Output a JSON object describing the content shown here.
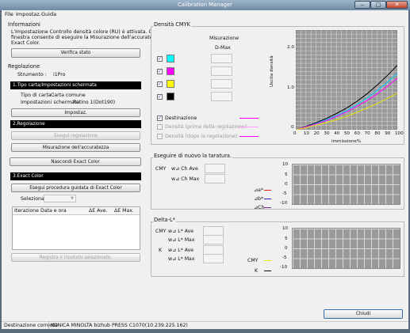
{
  "window": {
    "title": "Calibration Manager",
    "min": "‒",
    "max": "□",
    "close": "✕"
  },
  "menu": [
    "File",
    "Impostaz.",
    "Guida"
  ],
  "left": {
    "info_heading": "Informazioni",
    "info_line1": "L'Impostazione Controllo densità colore (RU) è attivata. Questa",
    "info_line2": "finestra consente di eseguire la Misurazione dell'accuratezza e",
    "info_line3": "Exact Color.",
    "verify_button": "Verifica stato",
    "reg_heading": "Regolazione",
    "instrument_label": "Strumento :",
    "instrument_value": "i1Pro",
    "section1": "1.Tipo carta/Impostazioni schermata",
    "paper_label": "Tipo di carta :",
    "paper_value": "Carta comune",
    "screen_label": "Impostazioni schermata :",
    "screen_value": "Retino 1(Dot190)",
    "settings_button": "Impostaz.",
    "section2": "2.Regolazione",
    "run_adjust_button": "Esegui regolazione",
    "accuracy_button": "Misurazione dell'accuratezza",
    "hide_exact_button": "Nascondi Exact Color",
    "section3": "3.Exact Color",
    "exact_guided_button": "Esegui procedura guidata di Exact Color",
    "select_label": "Seleziona",
    "select_value": "",
    "table_headers": [
      "Iterazione",
      "Data e ora",
      "ΔE Ave.",
      "ΔE Max."
    ],
    "register_button": "Registra il risultato selezionato."
  },
  "cmyk": {
    "heading": "Densità CMYK",
    "measure_label": "Misurazione",
    "dmax_label": "D-Max",
    "colors": [
      "#00ffff",
      "#ff00ff",
      "#ffff00",
      "#000000"
    ],
    "check_mark": "✓",
    "legend": [
      {
        "label": "Destinazione",
        "color": "#ff00ff",
        "checked": true,
        "enabled": true
      },
      {
        "label": "Densità (prima della regolazione)",
        "color": "#ff9fff",
        "checked": false,
        "enabled": false
      },
      {
        "label": "Densità (dopo la regolazione)",
        "color": "#ff00ff",
        "checked": false,
        "enabled": false
      }
    ],
    "ylabel": "Uscita densità",
    "xlabel": "immissione%",
    "y_ticks": [
      "2.0",
      "1.0",
      "0"
    ],
    "x_ticks": [
      "0",
      "10",
      "20",
      "30",
      "40",
      "50",
      "60",
      "70",
      "80",
      "90",
      "100"
    ]
  },
  "rerun": {
    "heading": "Eseguire di nuovo la taratura.",
    "cmy_label": "CMY",
    "ch_ave_label": "w⊿ Ch Ave",
    "ch_max_label": "w⊿ Ch Max",
    "legend": [
      {
        "label": "⊿a*",
        "color": "#e02020"
      },
      {
        "label": "⊿b*",
        "color": "#2020c0"
      },
      {
        "label": "⊿Ch",
        "color": "#7a20a0"
      }
    ],
    "y_ticks": [
      "10",
      "5",
      "0",
      "-5",
      "-10"
    ]
  },
  "delta": {
    "heading": "Delta-L*",
    "cmy_label": "CMY",
    "k_label": "K",
    "l_ave_label": "w⊿ L* Ave",
    "l_max_label": "w⊿ L* Max",
    "legend": [
      {
        "label": "CMY",
        "color": "#e6e600"
      },
      {
        "label": "K",
        "color": "#000000"
      }
    ],
    "y_ticks": [
      "10",
      "5",
      "0",
      "-5",
      "-10"
    ]
  },
  "close_button": "Chiudi",
  "status": {
    "label": "Destinazione corrente",
    "value": "KONICA MINOLTA bizhub PRESS C1070(10.239.225.162)"
  },
  "chart_data": {
    "type": "line",
    "title": "Densità CMYK",
    "xlabel": "immissione%",
    "ylabel": "Uscita densità",
    "xlim": [
      0,
      100
    ],
    "ylim": [
      0,
      2.4
    ],
    "grid": true,
    "x": [
      0,
      10,
      20,
      30,
      40,
      50,
      60,
      70,
      80,
      90,
      100
    ],
    "series": [
      {
        "color": "#000000",
        "values": [
          0,
          0.08,
          0.17,
          0.27,
          0.39,
          0.52,
          0.68,
          0.86,
          1.07,
          1.3,
          1.55
        ]
      },
      {
        "color": "#00c8ff",
        "values": [
          0,
          0.07,
          0.15,
          0.24,
          0.34,
          0.46,
          0.6,
          0.76,
          0.94,
          1.14,
          1.36
        ]
      },
      {
        "color": "#ff00ff",
        "values": [
          0,
          0.07,
          0.14,
          0.22,
          0.32,
          0.43,
          0.56,
          0.7,
          0.86,
          1.04,
          1.24
        ]
      },
      {
        "color": "#e6e600",
        "values": [
          0,
          0.05,
          0.11,
          0.17,
          0.24,
          0.32,
          0.42,
          0.52,
          0.63,
          0.75,
          0.88
        ]
      }
    ]
  }
}
